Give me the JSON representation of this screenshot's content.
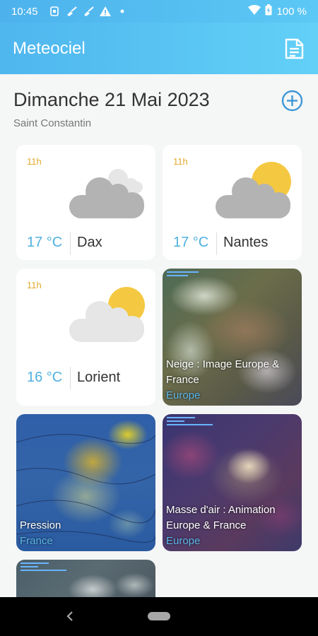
{
  "status_bar": {
    "time": "10:45",
    "battery": "100 %",
    "icons": [
      "sim-icon",
      "broom-icon",
      "broom-icon",
      "warning-icon",
      "dot-icon",
      "wifi-icon",
      "battery-icon"
    ]
  },
  "app_bar": {
    "title": "Meteociel",
    "icon": "document-icon"
  },
  "header": {
    "date": "Dimanche 21 Mai 2023",
    "location": "Saint Constantin",
    "add_icon": "plus-circle-icon"
  },
  "weather_cards": [
    {
      "hour": "11h",
      "temp": "17 °C",
      "city": "Dax",
      "icon": "cloudy-icon"
    },
    {
      "hour": "11h",
      "temp": "17 °C",
      "city": "Nantes",
      "icon": "partly-cloudy-icon"
    },
    {
      "hour": "11h",
      "temp": "16 °C",
      "city": "Lorient",
      "icon": "partly-cloudy-light-icon"
    }
  ],
  "image_cards": [
    {
      "title": "Neige : Image Europe & France",
      "region": "Europe"
    },
    {
      "title": "Pression",
      "region": "France"
    },
    {
      "title": "Masse d'air : Animation Europe & France",
      "region": "Europe"
    },
    {
      "title": "",
      "region": ""
    }
  ],
  "colors": {
    "accent": "#4fb6ee",
    "temp": "#4fb1e0",
    "hour": "#e3a92c",
    "region": "#5cb6ea"
  }
}
